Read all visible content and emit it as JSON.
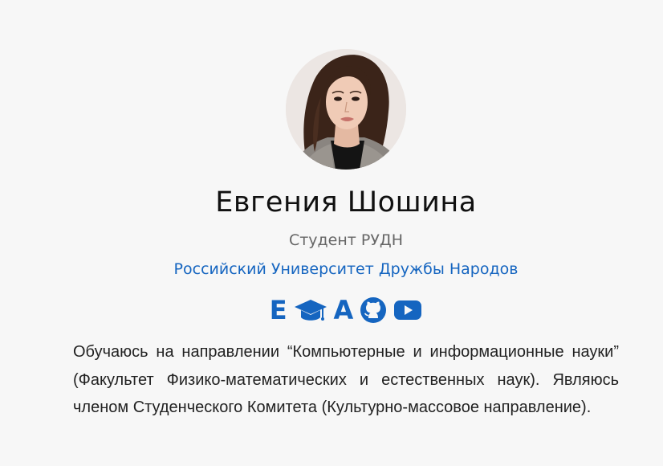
{
  "profile": {
    "name": "Евгения Шошина",
    "role": "Студент РУДН",
    "organization": "Российский Университет Дружбы Народов",
    "bio": "Обучаюсь на направлении “Компьютерные и информационные науки” (Факультет Физико-математических и естественных наук). Являюсь членом Студенческого Комитета (Культурно-массовое направление)."
  },
  "social_links": [
    {
      "icon": "email-icon",
      "glyph": "E"
    },
    {
      "icon": "graduation-cap-icon"
    },
    {
      "icon": "academia-icon",
      "glyph": "A"
    },
    {
      "icon": "github-icon"
    },
    {
      "icon": "youtube-icon"
    }
  ],
  "colors": {
    "background": "#f7f7f7",
    "accent": "#1565c0",
    "heading": "#111111",
    "muted": "#666666",
    "body_text": "#222222"
  }
}
